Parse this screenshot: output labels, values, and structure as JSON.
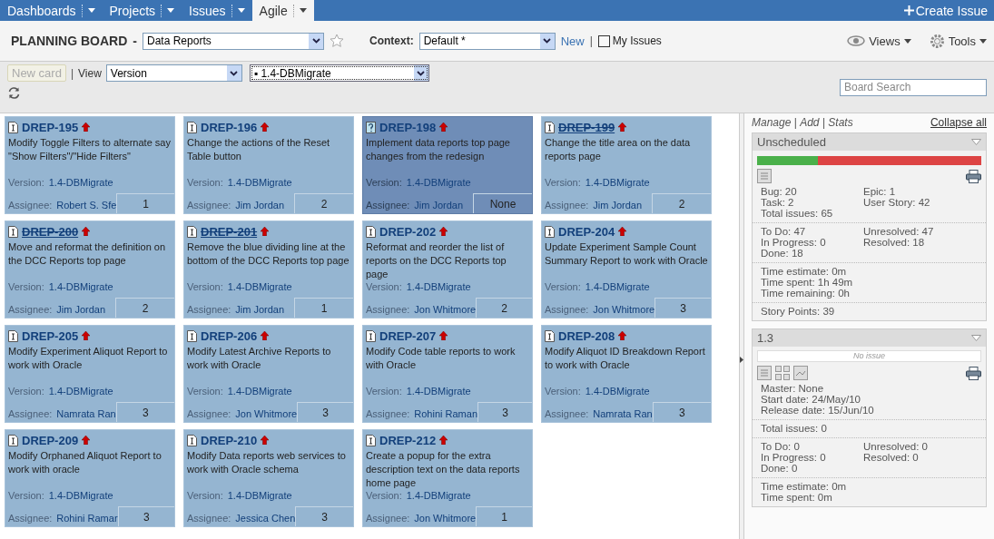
{
  "nav": {
    "items": [
      {
        "label": "Dashboards",
        "selected": false
      },
      {
        "label": "Projects",
        "selected": false
      },
      {
        "label": "Issues",
        "selected": false
      },
      {
        "label": "Agile",
        "selected": true
      }
    ],
    "create": "Create Issue"
  },
  "header": {
    "title": "PLANNING BOARD",
    "separator": "-",
    "board": "Data Reports",
    "context_label": "Context:",
    "context": "Default *",
    "new_link": "New",
    "divider": "|",
    "my_issues": {
      "label": "My Issues",
      "checked": false
    },
    "views": "Views",
    "tools": "Tools"
  },
  "toolbar": {
    "new_card": {
      "label": "New card",
      "disabled": true
    },
    "divider": "|",
    "view_label": "View",
    "view": "Version",
    "version": "▪ 1.4-DBMigrate",
    "search_placeholder": "Board Search"
  },
  "cards": [
    {
      "key": "DREP-195",
      "kind": "story",
      "resolved": false,
      "selected": false,
      "summary": "Modify Toggle Filters to alternate say \"Show Filters\"/\"Hide Filters\"",
      "version_label": "Version:",
      "version": "1.4-DBMigrate",
      "assignee_label": "Assignee:",
      "assignee": "Robert S. Sfe",
      "points": "1"
    },
    {
      "key": "DREP-196",
      "kind": "story",
      "resolved": false,
      "selected": false,
      "summary": "Change the actions of the Reset Table button",
      "version_label": "Version:",
      "version": "1.4-DBMigrate",
      "assignee_label": "Assignee:",
      "assignee": "Jim Jordan",
      "points": "2"
    },
    {
      "key": "DREP-198",
      "kind": "question",
      "resolved": false,
      "selected": true,
      "summary": "Implement data reports top page changes from the redesign",
      "version_label": "Version:",
      "version": "1.4-DBMigrate",
      "assignee_label": "Assignee:",
      "assignee": "Jim Jordan",
      "points": "None"
    },
    {
      "key": "DREP-199",
      "kind": "story",
      "resolved": true,
      "selected": false,
      "summary": "Change the title area on the data reports page",
      "version_label": "Version:",
      "version": "1.4-DBMigrate",
      "assignee_label": "Assignee:",
      "assignee": "Jim Jordan",
      "points": "2"
    },
    {
      "key": "DREP-200",
      "kind": "story",
      "resolved": true,
      "selected": false,
      "summary": "Move and reformat the definition on the DCC Reports top page",
      "version_label": "Version:",
      "version": "1.4-DBMigrate",
      "assignee_label": "Assignee:",
      "assignee": "Jim Jordan",
      "points": "2"
    },
    {
      "key": "DREP-201",
      "kind": "story",
      "resolved": true,
      "selected": false,
      "summary": "Remove the blue dividing line at the bottom of the DCC Reports top page",
      "version_label": "Version:",
      "version": "1.4-DBMigrate",
      "assignee_label": "Assignee:",
      "assignee": "Jim Jordan",
      "points": "1"
    },
    {
      "key": "DREP-202",
      "kind": "story",
      "resolved": false,
      "selected": false,
      "summary": "Reformat and reorder the list of reports on the DCC Reports top page",
      "version_label": "Version:",
      "version": "1.4-DBMigrate",
      "assignee_label": "Assignee:",
      "assignee": "Jon Whitmore",
      "points": "2"
    },
    {
      "key": "DREP-204",
      "kind": "story",
      "resolved": false,
      "selected": false,
      "summary": "Update Experiment Sample Count Summary Report to work with Oracle",
      "version_label": "Version:",
      "version": "1.4-DBMigrate",
      "assignee_label": "Assignee:",
      "assignee": "Jon Whitmore",
      "points": "3"
    },
    {
      "key": "DREP-205",
      "kind": "story",
      "resolved": false,
      "selected": false,
      "summary": "Modify Experiment Aliquot Report to work with Oracle",
      "version_label": "Version:",
      "version": "1.4-DBMigrate",
      "assignee_label": "Assignee:",
      "assignee": "Namrata Ran",
      "points": "3"
    },
    {
      "key": "DREP-206",
      "kind": "story",
      "resolved": false,
      "selected": false,
      "summary": "Modify Latest Archive Reports to work with Oracle",
      "version_label": "Version:",
      "version": "1.4-DBMigrate",
      "assignee_label": "Assignee:",
      "assignee": "Jon Whitmore",
      "points": "3"
    },
    {
      "key": "DREP-207",
      "kind": "story",
      "resolved": false,
      "selected": false,
      "summary": "Modify Code table reports to work with Oracle",
      "version_label": "Version:",
      "version": "1.4-DBMigrate",
      "assignee_label": "Assignee:",
      "assignee": "Rohini Raman",
      "points": "3"
    },
    {
      "key": "DREP-208",
      "kind": "story",
      "resolved": false,
      "selected": false,
      "summary": "Modify Aliquot ID Breakdown Report to work with Oracle",
      "version_label": "Version:",
      "version": "1.4-DBMigrate",
      "assignee_label": "Assignee:",
      "assignee": "Namrata Ran",
      "points": "3"
    },
    {
      "key": "DREP-209",
      "kind": "story",
      "resolved": false,
      "selected": false,
      "summary": "Modify Orphaned Aliquot Report to work with oracle",
      "version_label": "Version:",
      "version": "1.4-DBMigrate",
      "assignee_label": "Assignee:",
      "assignee": "Rohini Ramar",
      "points": "3"
    },
    {
      "key": "DREP-210",
      "kind": "story",
      "resolved": false,
      "selected": false,
      "summary": "Modify Data reports web services to work with Oracle schema",
      "version_label": "Version:",
      "version": "1.4-DBMigrate",
      "assignee_label": "Assignee:",
      "assignee": "Jessica Chen",
      "points": "3"
    },
    {
      "key": "DREP-212",
      "kind": "story",
      "resolved": false,
      "selected": false,
      "summary": "Create a popup for the extra description text on the data reports home page",
      "version_label": "Version:",
      "version": "1.4-DBMigrate",
      "assignee_label": "Assignee:",
      "assignee": "Jon Whitmore",
      "points": "1"
    }
  ],
  "side": {
    "links": [
      "Manage",
      "Add",
      "Stats"
    ],
    "link_sep": "|",
    "collapse": "Collapse all",
    "versions": [
      {
        "name": "Unscheduled",
        "progress": {
          "kind": "bar",
          "level": 0.27
        },
        "tools": [
          {
            "kind": "list"
          }
        ],
        "groups": [
          {
            "left": [
              "Bug: 20",
              "Task: 2",
              "Total issues: 65"
            ],
            "right": [
              "Epic: 1",
              "User Story: 42"
            ]
          },
          {
            "left": [
              "To Do: 47",
              "In Progress: 0",
              "Done: 18"
            ],
            "right": [
              "Unresolved: 47",
              "Resolved: 18"
            ]
          },
          {
            "left": [
              "Time estimate: 0m",
              "Time spent: 1h 49m",
              "Time remaining: 0h"
            ]
          },
          {
            "left": [
              "Story Points: 39"
            ]
          }
        ]
      },
      {
        "name": "1.3",
        "progress": {
          "kind": "empty",
          "text": "No issue"
        },
        "tools": [
          {
            "kind": "list"
          },
          {
            "kind": "grid"
          },
          {
            "kind": "chart"
          }
        ],
        "groups": [
          {
            "left": [
              "Master: None",
              "Start date: 24/May/10",
              "Release date: 15/Jun/10"
            ]
          },
          {
            "left": [
              "Total issues: 0"
            ]
          },
          {
            "left": [
              "To Do: 0",
              "In Progress: 0",
              "Done: 0"
            ],
            "right": [
              "Unresolved: 0",
              "Resolved: 0"
            ]
          },
          {
            "left": [
              "Time estimate: 0m",
              "Time spent: 0m"
            ]
          }
        ]
      }
    ]
  }
}
